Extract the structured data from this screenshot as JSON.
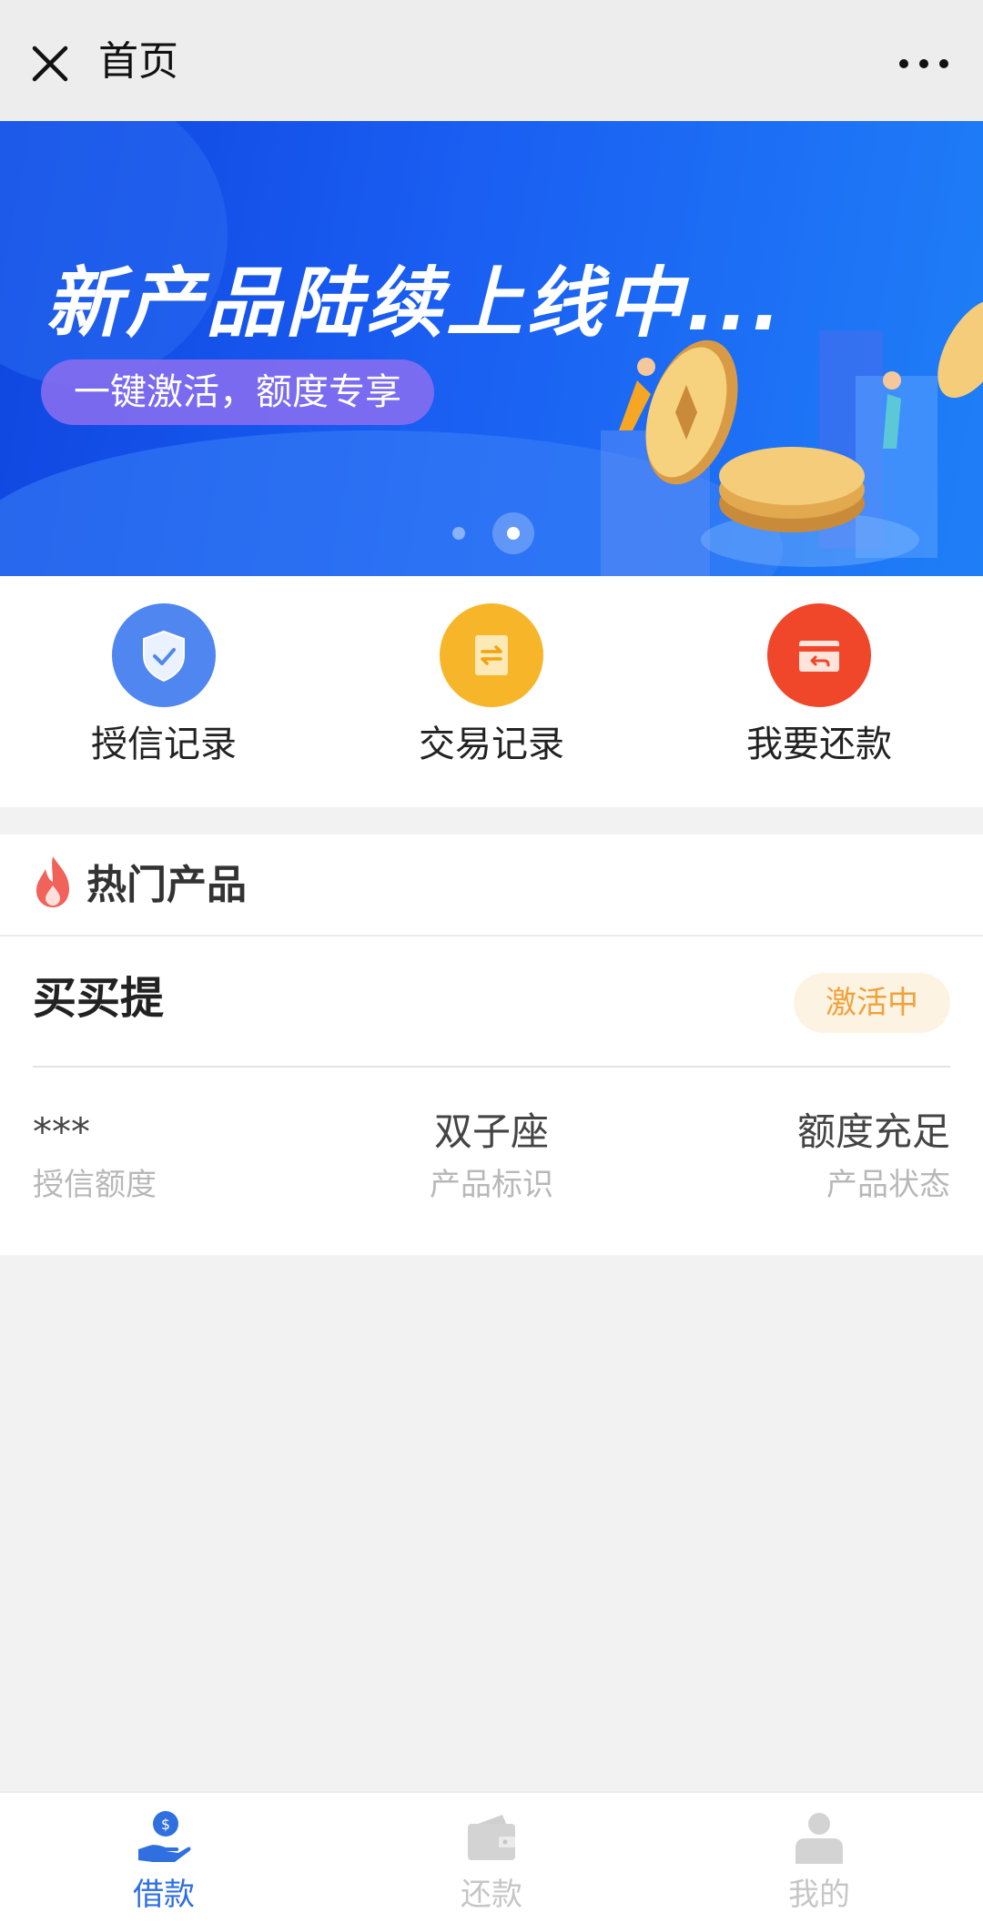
{
  "titlebar": {
    "title": "首页",
    "close_icon": "close-icon",
    "more_icon": "more-icon"
  },
  "banner": {
    "headline": "新产品陆续上线中...",
    "subtitle": "一键激活，额度专享",
    "slides_total": 2,
    "slide_active": 2
  },
  "quick_actions": [
    {
      "label": "授信记录",
      "icon": "shield-check-icon",
      "color": "#4f86f0"
    },
    {
      "label": "交易记录",
      "icon": "transfer-icon",
      "color": "#f7b52a"
    },
    {
      "label": "我要还款",
      "icon": "repay-card-icon",
      "color": "#f0462a"
    }
  ],
  "hot_products": {
    "title": "热门产品",
    "icon": "fire-icon",
    "product": {
      "name": "买买提",
      "status_badge": "激活中",
      "stats": [
        {
          "value": "***",
          "label": "授信额度"
        },
        {
          "value": "双子座",
          "label": "产品标识"
        },
        {
          "value": "额度充足",
          "label": "产品状态"
        }
      ]
    }
  },
  "tabbar": {
    "items": [
      {
        "label": "借款",
        "icon": "loan-hand-icon",
        "active": true
      },
      {
        "label": "还款",
        "icon": "wallet-icon",
        "active": false
      },
      {
        "label": "我的",
        "icon": "user-icon",
        "active": false
      }
    ],
    "active_color": "#2f6fe0"
  }
}
